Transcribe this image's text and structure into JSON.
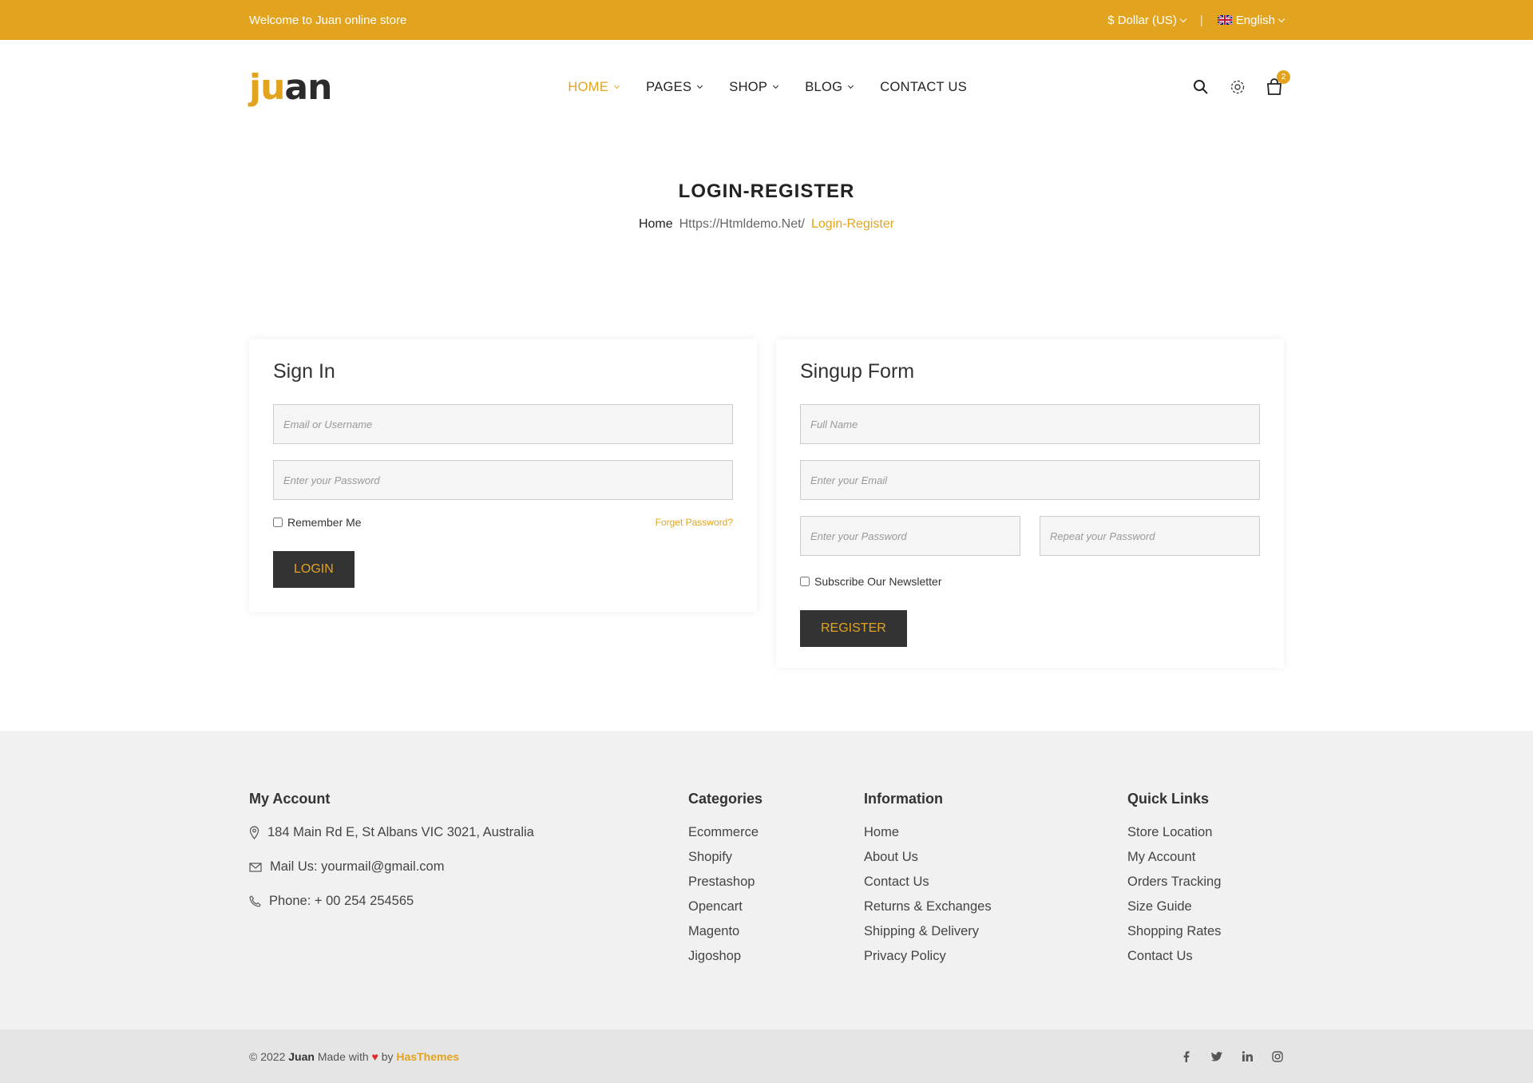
{
  "topbar": {
    "welcome": "Welcome to Juan online store",
    "currency": "$ Dollar (US)",
    "language": "English",
    "separator": "|"
  },
  "logo": {
    "part1": "ju",
    "part2": "an"
  },
  "nav": [
    {
      "label": "HOME",
      "active": true,
      "has_dropdown": true
    },
    {
      "label": "PAGES",
      "has_dropdown": true
    },
    {
      "label": "SHOP",
      "has_dropdown": true
    },
    {
      "label": "BLOG",
      "has_dropdown": true
    },
    {
      "label": "CONTACT US",
      "has_dropdown": false
    }
  ],
  "header_icons": {
    "cart_count": "2"
  },
  "page": {
    "title": "LOGIN-REGISTER",
    "breadcrumb": [
      "Home",
      "Https://Htmldemo.Net/",
      "Login-Register"
    ]
  },
  "signin": {
    "title": "Sign In",
    "email_placeholder": "Email or Username",
    "password_placeholder": "Enter your Password",
    "remember_label": "Remember Me",
    "forget_label": "Forget Password?",
    "login_button": "LOGIN"
  },
  "signup": {
    "title": "Singup Form",
    "fullname_placeholder": "Full Name",
    "email_placeholder": "Enter your Email",
    "password_placeholder": "Enter your Password",
    "repeat_placeholder": "Repeat your Password",
    "newsletter_label": "Subscribe Our Newsletter",
    "register_button": "REGISTER"
  },
  "footer": {
    "my_account": {
      "title": "My Account",
      "address": "184 Main Rd E, St Albans VIC 3021, Australia",
      "mail": "Mail Us: yourmail@gmail.com",
      "phone": "Phone: + 00 254 254565"
    },
    "categories": {
      "title": "Categories",
      "items": [
        "Ecommerce",
        "Shopify",
        "Prestashop",
        "Opencart",
        "Magento",
        "Jigoshop"
      ]
    },
    "information": {
      "title": "Information",
      "items": [
        "Home",
        "About Us",
        "Contact Us",
        "Returns & Exchanges",
        "Shipping & Delivery",
        "Privacy Policy"
      ]
    },
    "quick_links": {
      "title": "Quick Links",
      "items": [
        "Store Location",
        "My Account",
        "Orders Tracking",
        "Size Guide",
        "Shopping Rates",
        "Contact Us"
      ]
    }
  },
  "copyright": {
    "prefix": "© 2022",
    "brand": "Juan",
    "made_with": "Made with",
    "by": "by",
    "author": "HasThemes"
  },
  "colors": {
    "accent": "#e2a41f",
    "dark_button": "#333333",
    "footer_bg": "#f1f1f1"
  },
  "social_icons": [
    "facebook-icon",
    "twitter-icon",
    "linkedin-icon",
    "instagram-icon"
  ]
}
